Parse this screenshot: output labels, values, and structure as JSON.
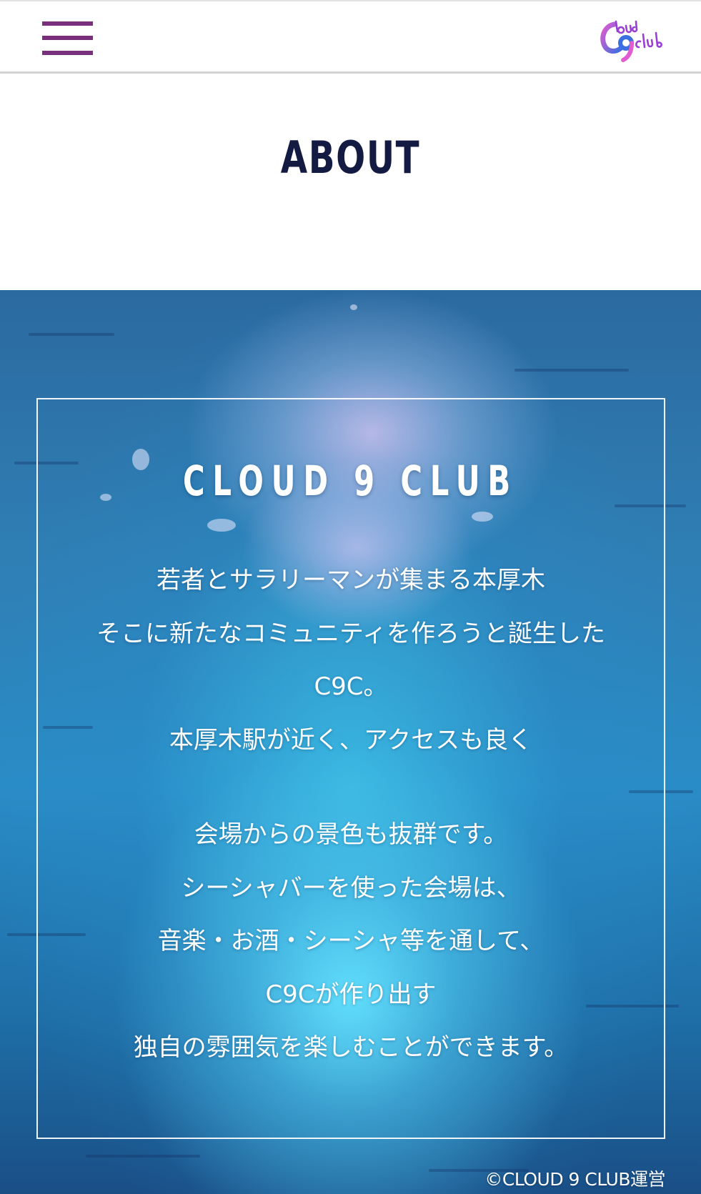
{
  "colors": {
    "accent": "#7a2f7d",
    "title": "#131b43",
    "hero_text": "#ffffff",
    "logo_pink": "#e25bd0",
    "logo_blue": "#3b6fe0"
  },
  "header": {
    "menu_icon": "hamburger-menu-icon",
    "logo_text": "Cloud 9 Club"
  },
  "page": {
    "title": "ABOUT"
  },
  "hero": {
    "club_name": "CLOUD 9 CLUB",
    "lines": [
      "若者とサラリーマンが集まる本厚木",
      "そこに新たなコミュニティを作ろうと誕生した",
      "C9C。",
      "本厚木駅が近く、アクセスも良く",
      "",
      "会場からの景色も抜群です。",
      "シーシャバーを使った会場は、",
      "音楽・お酒・シーシャ等を通して、",
      "C9Cが作り出す",
      "独自の雰囲気を楽しむことができます。"
    ],
    "copyright": "©CLOUD 9 CLUB運営"
  }
}
